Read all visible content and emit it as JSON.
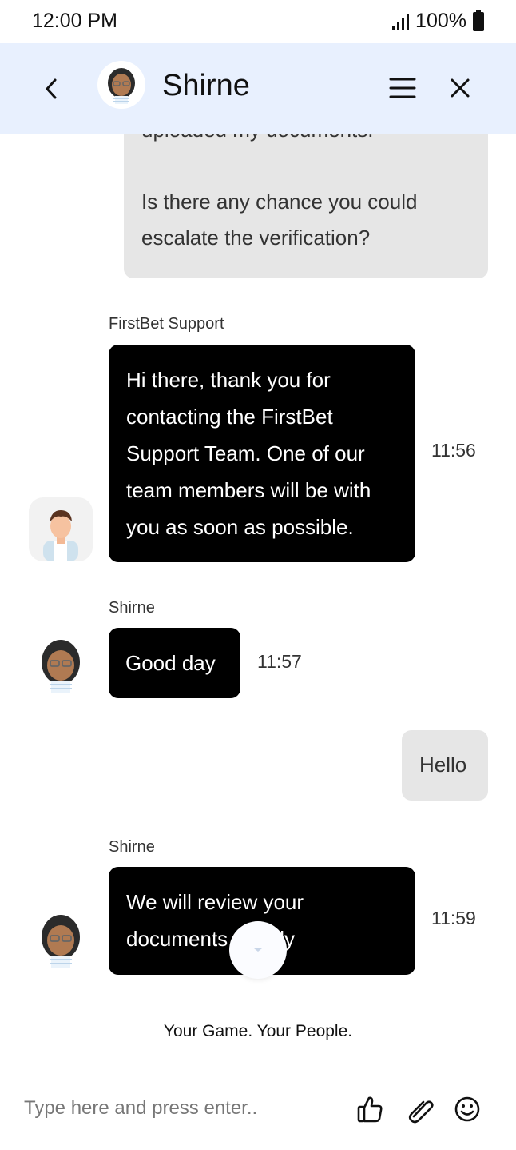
{
  "status_bar": {
    "time": "12:00 PM",
    "battery": "100%"
  },
  "header": {
    "title": "Shirne"
  },
  "messages": {
    "m1": {
      "text_top": "uploaded my documents.",
      "text_1": "Is there any chance you could",
      "text_2": "escalate the verification?"
    },
    "m2": {
      "sender": "FirstBet Support",
      "lines": [
        "Hi there, thank you for",
        "contacting the FirstBet",
        "Support Team. One of our",
        "team members will be with",
        "you as soon as possible."
      ],
      "time": "11:56"
    },
    "m3": {
      "sender": "Shirne",
      "text": "Good day",
      "time": "11:57"
    },
    "m4": {
      "text": "Hello"
    },
    "m5": {
      "sender": "Shirne",
      "line1": "We will review your",
      "line2": "documents shortly",
      "time": "11:59"
    }
  },
  "footer": {
    "tagline": "Your Game. Your People."
  },
  "composer": {
    "placeholder": "Type here and press enter.."
  },
  "colors": {
    "header_bg": "#e8f0fe",
    "agent_bubble": "#000000",
    "user_bubble": "#e6e6e6"
  }
}
